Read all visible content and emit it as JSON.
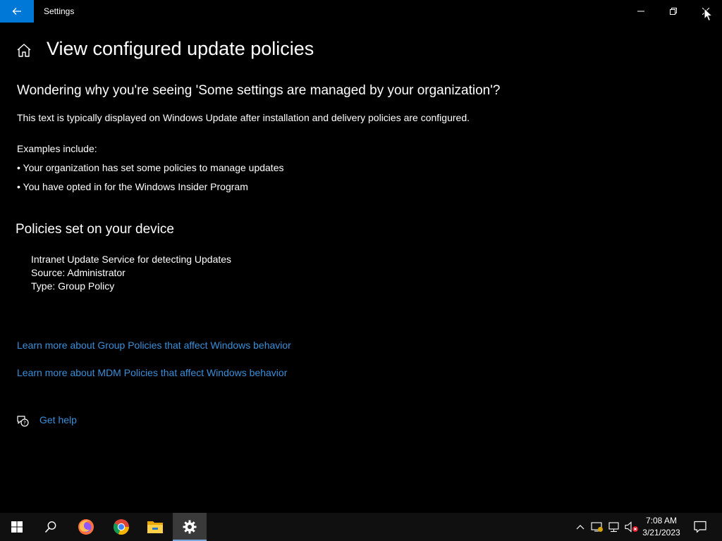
{
  "window": {
    "app_title": "Settings"
  },
  "header": {
    "page_title": "View configured update policies"
  },
  "intro": {
    "subheading": "Wondering why you're seeing 'Some settings are managed by your organization'?",
    "description": "This text is typically displayed on Windows Update after installation and delivery policies are configured.",
    "examples_label": "Examples include:",
    "examples": [
      "• Your organization has set some policies to manage updates",
      "• You have opted in for the Windows Insider Program"
    ]
  },
  "policies": {
    "heading": "Policies set on your device",
    "items": [
      {
        "name": "Intranet Update Service for detecting Updates",
        "source": "Source: Administrator",
        "type": "Type: Group Policy"
      }
    ]
  },
  "links": {
    "group_policies": "Learn more about Group Policies that affect Windows behavior",
    "mdm_policies": "Learn more about MDM Policies that affect Windows behavior",
    "get_help": "Get help"
  },
  "taskbar": {
    "time": "7:08 AM",
    "date": "3/21/2023",
    "pinned": [
      "start-icon",
      "search-icon",
      "firefox-icon",
      "chrome-icon",
      "file-explorer-icon",
      "settings-gear-icon"
    ]
  },
  "colors": {
    "accent": "#0078d7",
    "link": "#3a8fd9",
    "background": "#000000",
    "taskbar": "#101010"
  }
}
